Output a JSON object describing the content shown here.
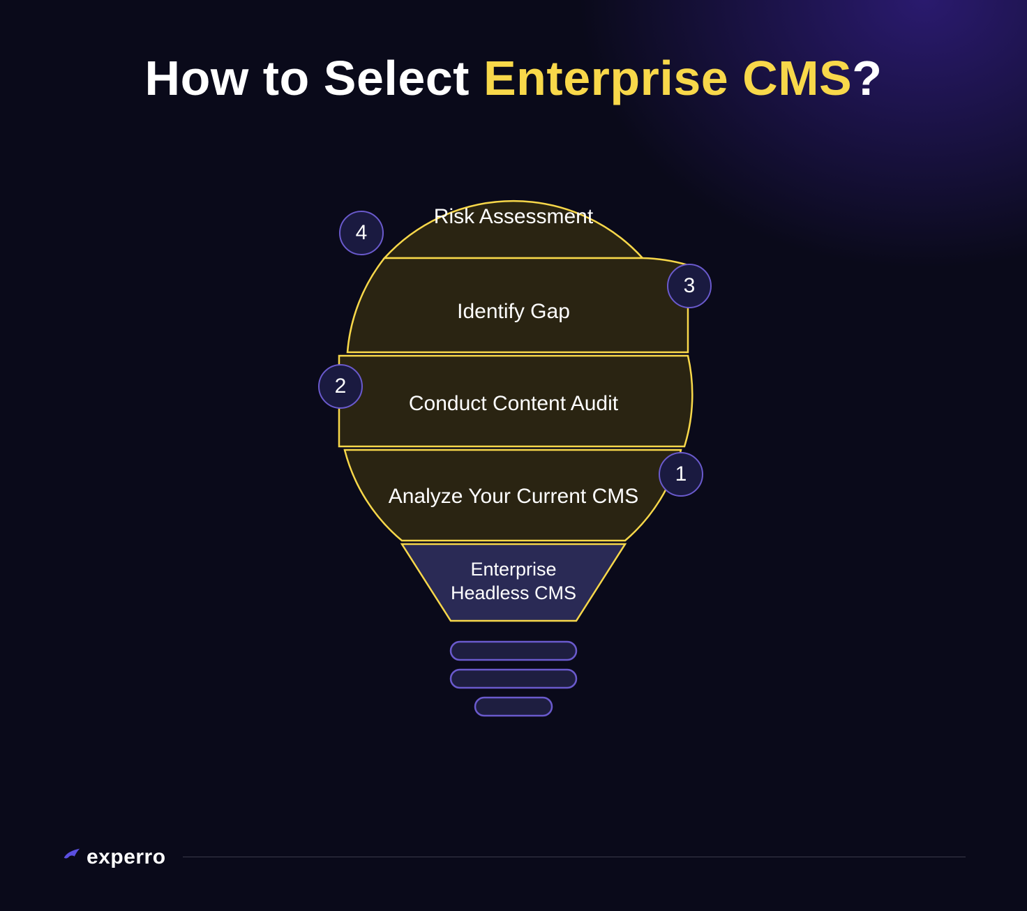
{
  "title": {
    "prefix": "How to Select ",
    "highlight": "Enterprise CMS",
    "suffix": "?"
  },
  "steps": [
    {
      "number": "4",
      "label": "Risk Assessment"
    },
    {
      "number": "3",
      "label": "Identify Gap"
    },
    {
      "number": "2",
      "label": "Conduct Content Audit"
    },
    {
      "number": "1",
      "label": "Analyze Your Current CMS"
    }
  ],
  "base_label_line1": "Enterprise",
  "base_label_line2": "Headless CMS",
  "brand": "experro",
  "colors": {
    "accent": "#f8d84a",
    "segment_fill": "#2a2412",
    "base_fill": "#2a2a55",
    "badge_fill": "#1a1a40",
    "badge_stroke": "#6a5acd"
  }
}
